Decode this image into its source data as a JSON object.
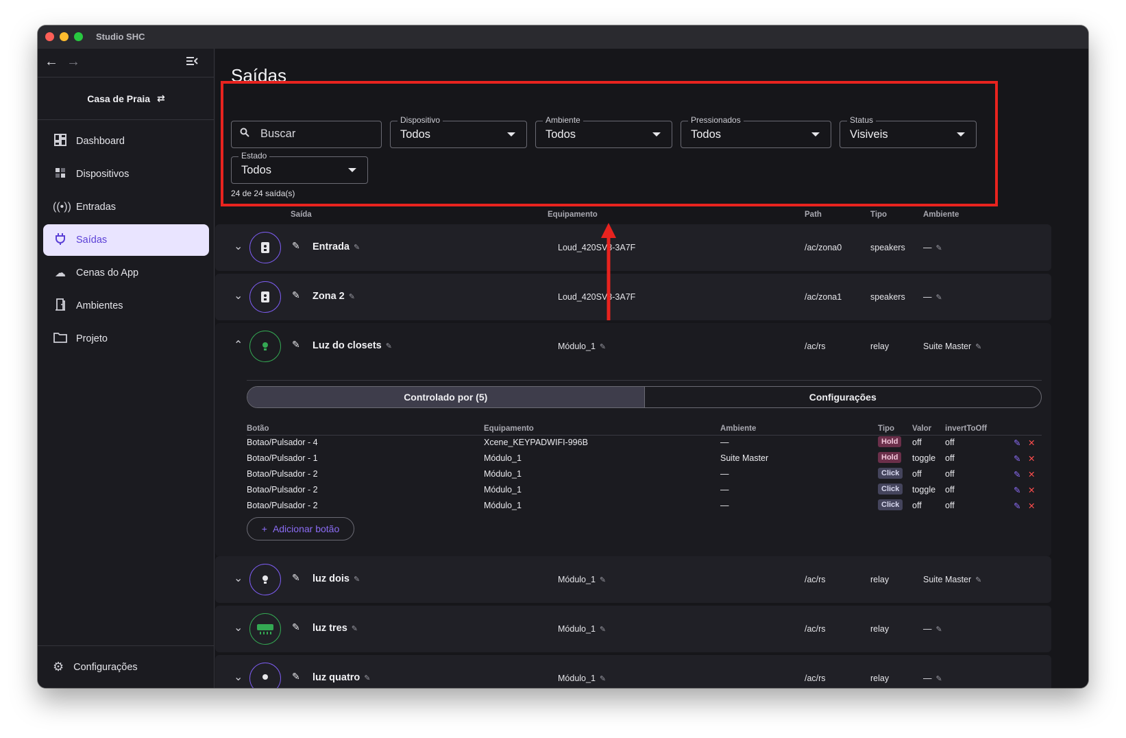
{
  "window": {
    "title": "Studio SHC"
  },
  "sidebar": {
    "project": "Casa de Praia",
    "items": [
      {
        "label": "Dashboard",
        "icon": "dashboard-icon",
        "active": false
      },
      {
        "label": "Dispositivos",
        "icon": "devices-icon",
        "active": false
      },
      {
        "label": "Entradas",
        "icon": "broadcast-icon",
        "active": false
      },
      {
        "label": "Saídas",
        "icon": "plug-icon",
        "active": true
      },
      {
        "label": "Cenas do App",
        "icon": "cloud-icon",
        "active": false
      },
      {
        "label": "Ambientes",
        "icon": "door-icon",
        "active": false
      },
      {
        "label": "Projeto",
        "icon": "folder-icon",
        "active": false
      }
    ],
    "footer": "Configurações"
  },
  "header": {
    "title": "Saídas",
    "search_placeholder": "Buscar",
    "filters": [
      {
        "label": "Dispositivo",
        "value": "Todos"
      },
      {
        "label": "Ambiente",
        "value": "Todos"
      },
      {
        "label": "Pressionados",
        "value": "Todos"
      },
      {
        "label": "Status",
        "value": "Visiveis"
      },
      {
        "label": "Estado",
        "value": "Todos"
      }
    ],
    "count": "24 de 24 saída(s)"
  },
  "table": {
    "headers": {
      "saida": "Saída",
      "equipamento": "Equipamento",
      "path": "Path",
      "tipo": "Tipo",
      "ambiente": "Ambiente"
    },
    "rows": [
      {
        "name": "Entrada",
        "equipamento": "Loud_420SV3-3A7F",
        "path": "/ac/zona0",
        "tipo": "speakers",
        "ambiente": "—",
        "icon": "speaker-icon"
      },
      {
        "name": "Zona 2",
        "equipamento": "Loud_420SV3-3A7F",
        "path": "/ac/zona1",
        "tipo": "speakers",
        "ambiente": "—",
        "icon": "speaker-icon"
      },
      {
        "name": "Luz do closets",
        "equipamento": "Módulo_1",
        "path": "/ac/rs",
        "tipo": "relay",
        "ambiente": "Suite Master",
        "icon": "bulb-icon"
      },
      {
        "name": "luz dois",
        "equipamento": "Módulo_1",
        "path": "/ac/rs",
        "tipo": "relay",
        "ambiente": "Suite Master",
        "icon": "bulb-icon"
      },
      {
        "name": "luz tres",
        "equipamento": "Módulo_1",
        "path": "/ac/rs",
        "tipo": "relay",
        "ambiente": "—",
        "icon": "air-conditioner-icon"
      },
      {
        "name": "luz quatro",
        "equipamento": "Módulo_1",
        "path": "/ac/rs",
        "tipo": "relay",
        "ambiente": "—",
        "icon": "bulb-icon"
      }
    ]
  },
  "expanded": {
    "tabs": [
      "Controlado por (5)",
      "Configurações"
    ],
    "headers": {
      "botao": "Botão",
      "equipamento": "Equipamento",
      "ambiente": "Ambiente",
      "tipo": "Tipo",
      "valor": "Valor",
      "invert": "invertToOff"
    },
    "rows": [
      {
        "botao": "Botao/Pulsador - 4",
        "equipamento": "Xcene_KEYPADWIFI-996B",
        "ambiente": "—",
        "tipo": "Hold",
        "valor": "off",
        "invert": "off"
      },
      {
        "botao": "Botao/Pulsador - 1",
        "equipamento": "Módulo_1",
        "ambiente": "Suite Master",
        "tipo": "Hold",
        "valor": "toggle",
        "invert": "off"
      },
      {
        "botao": "Botao/Pulsador - 2",
        "equipamento": "Módulo_1",
        "ambiente": "—",
        "tipo": "Click",
        "valor": "off",
        "invert": "off"
      },
      {
        "botao": "Botao/Pulsador - 2",
        "equipamento": "Módulo_1",
        "ambiente": "—",
        "tipo": "Click",
        "valor": "toggle",
        "invert": "off"
      },
      {
        "botao": "Botao/Pulsador - 2",
        "equipamento": "Módulo_1",
        "ambiente": "—",
        "tipo": "Click",
        "valor": "off",
        "invert": "off"
      }
    ],
    "add_button": "Adicionar botão"
  },
  "colors": {
    "accent": "#5a3fd6",
    "highlight_box": "#e8231f",
    "active_nav_bg": "#e9e4ff"
  }
}
